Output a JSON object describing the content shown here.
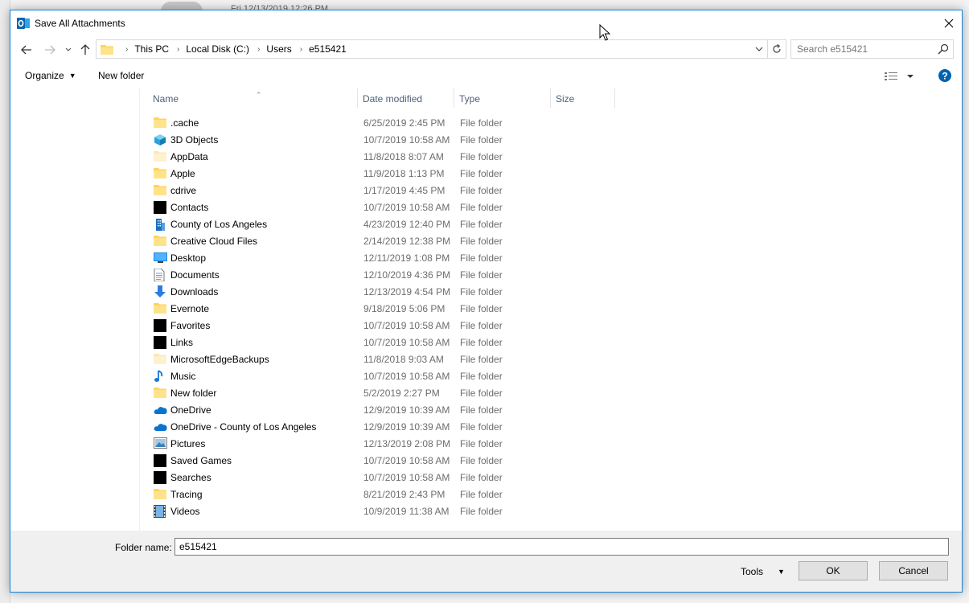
{
  "background": {
    "timestamp": "Fri 12/13/2019 12:26 PM"
  },
  "window": {
    "title": "Save All Attachments",
    "app_icon": "outlook-icon",
    "accent": "#1883d7"
  },
  "navigation": {
    "breadcrumbs": [
      "This PC",
      "Local Disk (C:)",
      "Users",
      "e515421"
    ],
    "search_placeholder": "Search e515421"
  },
  "toolbar": {
    "organize_label": "Organize",
    "new_folder_label": "New folder"
  },
  "columns": {
    "name": "Name",
    "date_modified": "Date modified",
    "type": "Type",
    "size": "Size"
  },
  "files": [
    {
      "name": ".cache",
      "date": "6/25/2019 2:45 PM",
      "type": "File folder",
      "icon": "folder"
    },
    {
      "name": "3D Objects",
      "date": "10/7/2019 10:58 AM",
      "type": "File folder",
      "icon": "3d-objects"
    },
    {
      "name": "AppData",
      "date": "11/8/2018 8:07 AM",
      "type": "File folder",
      "icon": "folder-faded"
    },
    {
      "name": "Apple",
      "date": "11/9/2018 1:13 PM",
      "type": "File folder",
      "icon": "folder"
    },
    {
      "name": "cdrive",
      "date": "1/17/2019 4:45 PM",
      "type": "File folder",
      "icon": "folder"
    },
    {
      "name": "Contacts",
      "date": "10/7/2019 10:58 AM",
      "type": "File folder",
      "icon": "black-square"
    },
    {
      "name": "County of Los Angeles",
      "date": "4/23/2019 12:40 PM",
      "type": "File folder",
      "icon": "building"
    },
    {
      "name": "Creative Cloud Files",
      "date": "2/14/2019 12:38 PM",
      "type": "File folder",
      "icon": "folder"
    },
    {
      "name": "Desktop",
      "date": "12/11/2019 1:08 PM",
      "type": "File folder",
      "icon": "desktop"
    },
    {
      "name": "Documents",
      "date": "12/10/2019 4:36 PM",
      "type": "File folder",
      "icon": "documents"
    },
    {
      "name": "Downloads",
      "date": "12/13/2019 4:54 PM",
      "type": "File folder",
      "icon": "downloads"
    },
    {
      "name": "Evernote",
      "date": "9/18/2019 5:06 PM",
      "type": "File folder",
      "icon": "folder"
    },
    {
      "name": "Favorites",
      "date": "10/7/2019 10:58 AM",
      "type": "File folder",
      "icon": "black-square"
    },
    {
      "name": "Links",
      "date": "10/7/2019 10:58 AM",
      "type": "File folder",
      "icon": "black-square"
    },
    {
      "name": "MicrosoftEdgeBackups",
      "date": "11/8/2018 9:03 AM",
      "type": "File folder",
      "icon": "folder-faded"
    },
    {
      "name": "Music",
      "date": "10/7/2019 10:58 AM",
      "type": "File folder",
      "icon": "music"
    },
    {
      "name": "New folder",
      "date": "5/2/2019 2:27 PM",
      "type": "File folder",
      "icon": "folder"
    },
    {
      "name": "OneDrive",
      "date": "12/9/2019 10:39 AM",
      "type": "File folder",
      "icon": "cloud"
    },
    {
      "name": "OneDrive - County of Los Angeles",
      "date": "12/9/2019 10:39 AM",
      "type": "File folder",
      "icon": "cloud"
    },
    {
      "name": "Pictures",
      "date": "12/13/2019 2:08 PM",
      "type": "File folder",
      "icon": "pictures"
    },
    {
      "name": "Saved Games",
      "date": "10/7/2019 10:58 AM",
      "type": "File folder",
      "icon": "black-square"
    },
    {
      "name": "Searches",
      "date": "10/7/2019 10:58 AM",
      "type": "File folder",
      "icon": "black-square"
    },
    {
      "name": "Tracing",
      "date": "8/21/2019 2:43 PM",
      "type": "File folder",
      "icon": "folder"
    },
    {
      "name": "Videos",
      "date": "10/9/2019 11:38 AM",
      "type": "File folder",
      "icon": "videos"
    }
  ],
  "footer": {
    "folder_label": "Folder name:",
    "folder_value": "e515421",
    "tools_label": "Tools",
    "ok_label": "OK",
    "cancel_label": "Cancel"
  }
}
